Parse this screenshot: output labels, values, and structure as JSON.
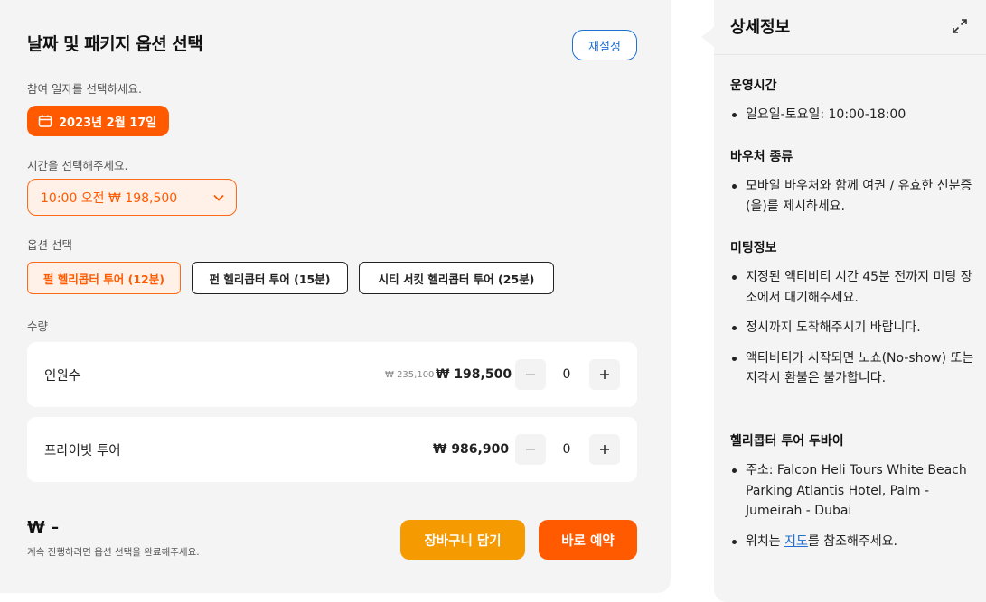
{
  "booking": {
    "title": "날짜 및 패키지 옵션 선택",
    "reset_label": "재설정",
    "date_prompt": "참여 일자를 선택하세요.",
    "date_value": "2023년 2월 17일",
    "time_prompt": "시간을 선택해주세요.",
    "time_value": "10:00 오전 ₩ 198,500",
    "option_prompt": "옵션 선택",
    "options": [
      {
        "label": "펄 헬리콥터 투어 (12분)",
        "selected": true
      },
      {
        "label": "펀 헬리콥터 투어 (15분)",
        "selected": false
      },
      {
        "label": "시티 서킷 헬리콥터 투어 (25분)",
        "selected": false
      }
    ],
    "quantity_prompt": "수량",
    "quantities": [
      {
        "name": "인원수",
        "old_price": "₩ 235,100",
        "price": "₩ 198,500",
        "count": "0"
      },
      {
        "name": "프라이빗 투어",
        "old_price": "",
        "price": "₩ 986,900",
        "count": "0"
      }
    ],
    "total": "₩ –",
    "total_note": "계속 진행하려면 옵션 선택을 완료해주세요.",
    "cart_label": "장바구니 담기",
    "book_label": "바로 예약"
  },
  "details": {
    "title": "상세정보",
    "sections": [
      {
        "heading": "운영시간",
        "items": [
          "일요일-토요일: 10:00-18:00"
        ]
      },
      {
        "heading": "바우처 종류",
        "items": [
          "모바일 바우처와 함께 여권 / 유효한 신분증(을)를 제시하세요."
        ]
      },
      {
        "heading": "미팅정보",
        "items": [
          "지정된 액티비티 시간 45분 전까지 미팅 장소에서 대기해주세요.",
          "정시까지 도착해주시기 바랍니다.",
          "액티비티가 시작되면 노쇼(No-show) 또는 지각시 환불은 불가합니다."
        ]
      },
      {
        "heading": "헬리콥터 투어 두바이",
        "items": [
          "주소: Falcon Heli Tours White Beach Parking Atlantis Hotel, Palm - Jumeirah - Dubai"
        ]
      }
    ],
    "map_prefix": "위치는 ",
    "map_link": "지도",
    "map_suffix": "를 참조해주세요."
  },
  "colors": {
    "accent": "#ff5a00",
    "cart": "#f59a00",
    "link": "#1f6fd1"
  },
  "icons": {
    "date": "calendar-icon",
    "time": "chevron-down-icon",
    "minus": "minus-icon",
    "plus": "plus-icon",
    "expand": "expand-icon"
  }
}
